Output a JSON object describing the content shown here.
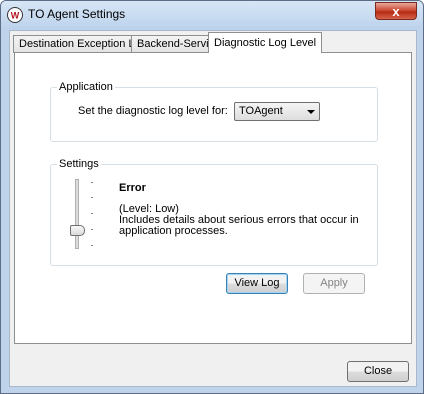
{
  "window": {
    "title": "TO Agent Settings",
    "close_glyph": "x"
  },
  "tabs": [
    {
      "label": "Destination Exception List",
      "active": false
    },
    {
      "label": "Backend-Service",
      "active": false
    },
    {
      "label": "Diagnostic Log Level",
      "active": true
    }
  ],
  "application": {
    "legend": "Application",
    "prompt": "Set the diagnostic log level for:",
    "selected": "TOAgent"
  },
  "settings": {
    "legend": "Settings",
    "level_name": "Error",
    "level_tag": "(Level: Low)",
    "description_line1": "Includes details about serious errors that occur in",
    "description_line2": "application processes."
  },
  "buttons": {
    "view_log": "View Log",
    "apply": "Apply",
    "close": "Close"
  },
  "icons": {
    "app": "watchguard-logo-icon",
    "close": "close-icon",
    "dropdown": "chevron-down-icon"
  },
  "colors": {
    "titlebar": "#bcd2ec",
    "close_button": "#c8422b",
    "client_bg": "#f0f0f0"
  }
}
